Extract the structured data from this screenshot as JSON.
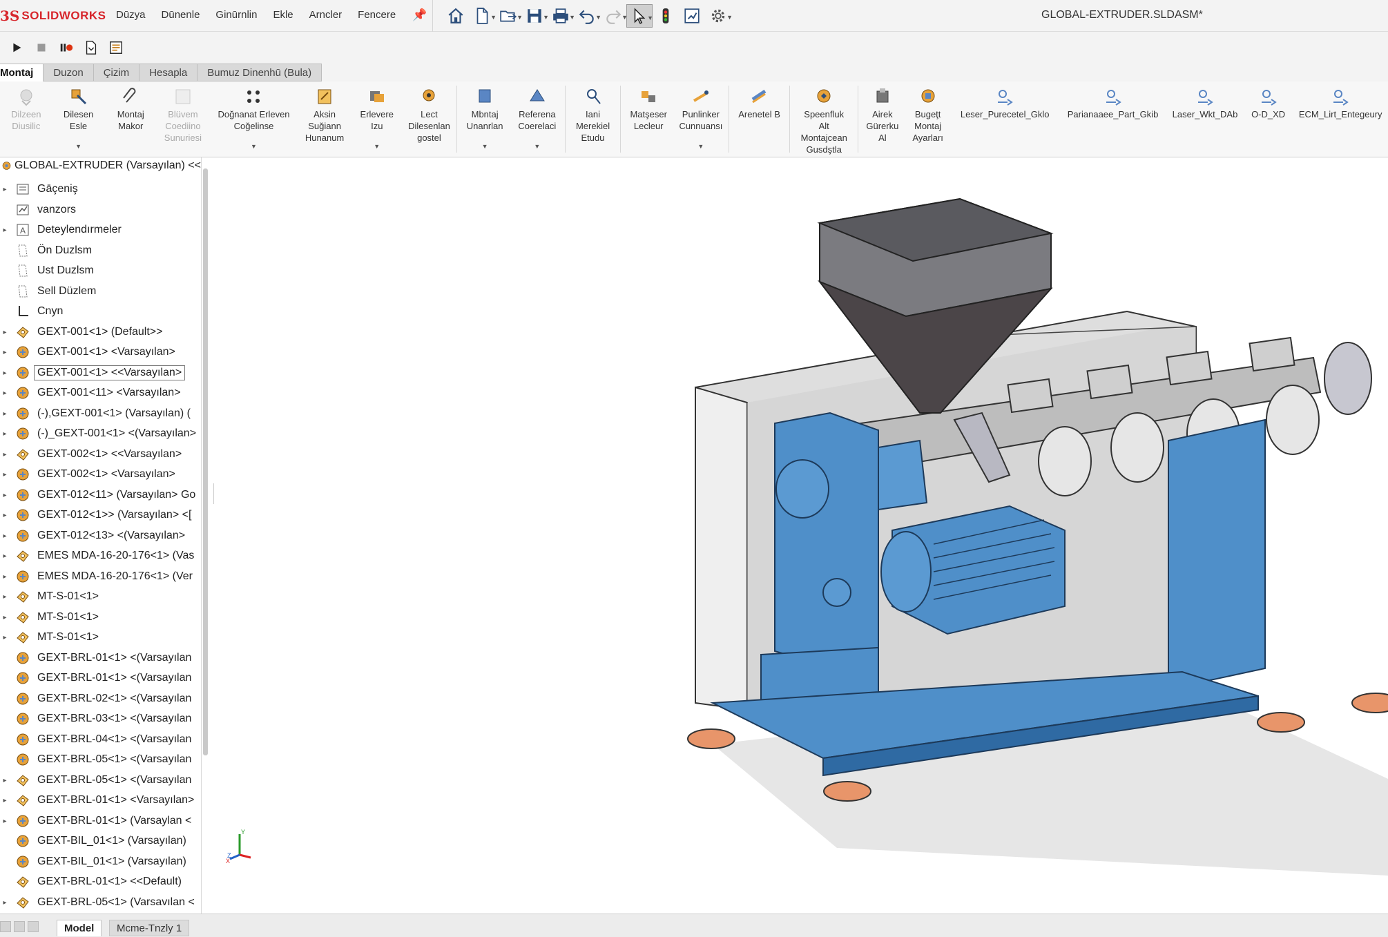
{
  "app": {
    "logo_prefix": "3S",
    "logo_name": "SOLIDWORKS",
    "document_title": "GLOBAL-EXTRUDER.SLDASM*"
  },
  "menu": [
    "Dūzya",
    "Dūnenle",
    "Ginūrnlin",
    "Ekle",
    "Arncler",
    "Fencere"
  ],
  "tabs": [
    "Montaj",
    "Duzon",
    "Çizim",
    "Hesapla",
    "Bumuz Dinenhū (Bula)"
  ],
  "ribbon": [
    {
      "label": "Dilzeen\nDiusilic",
      "icon": "insert-components-icon",
      "disabled": true
    },
    {
      "label": "Dilesen\nEsle",
      "icon": "mate-icon",
      "dropdown": true
    },
    {
      "label": "Montaj\nMakor",
      "icon": "component-preview-icon"
    },
    {
      "label": "Blüvem\nCoediino\nSunuriesi",
      "icon": "linear-pattern-icon",
      "disabled": true
    },
    {
      "label": "Doğnanat Erleven\nCoğelinse",
      "icon": "smart-fasteners-icon",
      "dropdown": true,
      "wide": true
    },
    {
      "label": "Aksin\nSuğiann\nHunanum",
      "icon": "move-component-icon"
    },
    {
      "label": "Erlevere\nIzu",
      "icon": "show-hidden-icon",
      "dropdown": true
    },
    {
      "label": "Lect\nDilesenlan\ngostel",
      "icon": "assembly-features-icon"
    },
    {
      "label": "Mbntaj\nUnanrlan",
      "icon": "reference-geometry-icon",
      "dropdown": true
    },
    {
      "label": "Referena\nCoerelaci",
      "icon": "new-motion-study-icon",
      "dropdown": true
    },
    {
      "label": "Iani\nMerekiel\nEtudu",
      "icon": "bill-of-materials-icon"
    },
    {
      "label": "Matşeser\nLecleur",
      "icon": "exploded-view-icon"
    },
    {
      "label": "Punlinker\nCunnuansı",
      "icon": "instant3d-icon",
      "dropdown": true
    },
    {
      "label": "Arenetel B",
      "icon": "update-speedpak-icon"
    },
    {
      "label": "Speenfluk\nAlt\nMontajcean\nGusdştla",
      "icon": "take-snapshot-icon"
    },
    {
      "label": "Airek\nGürerku\nAl",
      "icon": "large-assembly-icon"
    },
    {
      "label": "Bugeţt\nMontaj\nAyarları",
      "icon": "assembly-settings-icon"
    },
    {
      "label": "Leser_Purecetel_Gklo",
      "icon": "macro-icon",
      "wide2": true
    },
    {
      "label": "Parianaaee_Part_Gkib",
      "icon": "macro-icon",
      "wide2": true
    },
    {
      "label": "Laser_Wkt_DAb",
      "icon": "macro-icon",
      "wide3": true
    },
    {
      "label": "O-D_XD",
      "icon": "macro-icon"
    },
    {
      "label": "ECM_Lirt_Entegeury",
      "icon": "macro-icon",
      "wide2": true
    }
  ],
  "tree": {
    "root": "GLOBAL-EXTRUDER (Varsayılan) <<",
    "items": [
      {
        "label": "Gāçeniş",
        "icon": "history-icon",
        "expand": true
      },
      {
        "label": "vanzors",
        "icon": "sensors-icon",
        "expand": false
      },
      {
        "label": "Deteylendırmeler",
        "icon": "annotations-icon",
        "expand": true
      },
      {
        "label": "Ön Duzlsm",
        "icon": "plane-icon",
        "expand": false
      },
      {
        "label": "Ust Duzlsm",
        "icon": "plane-icon",
        "expand": false
      },
      {
        "label": "Sell Düzlem",
        "icon": "plane-icon",
        "expand": false
      },
      {
        "label": "Cnyn",
        "icon": "origin-icon",
        "expand": false
      },
      {
        "label": "GEXT-001<1> (Default>>",
        "icon": "part-icon",
        "expand": true
      },
      {
        "label": "GEXT-001<1> <Varsayılan>",
        "icon": "assembly-icon",
        "expand": true
      },
      {
        "label": "GEXT-001<1> <<Varsayılan>",
        "icon": "assembly-icon",
        "expand": true,
        "selected": true
      },
      {
        "label": "GEXT-001<11> <Varsayılan>",
        "icon": "assembly-icon",
        "expand": true
      },
      {
        "label": "(-),GEXT-001<1> (Varsayılan) (",
        "icon": "assembly-icon",
        "expand": true
      },
      {
        "label": "(-)_GEXT-001<1> <(Varsayılan>",
        "icon": "assembly-icon",
        "expand": true
      },
      {
        "label": "GEXT-002<1> <<Varsayılan>",
        "icon": "part-icon",
        "expand": true
      },
      {
        "label": "GEXT-002<1> <Varsayılan>",
        "icon": "assembly-icon",
        "expand": true
      },
      {
        "label": "GEXT-012<11> (Varsayılan> Go",
        "icon": "assembly-icon",
        "expand": true
      },
      {
        "label": "GEXT-012<1>> (Varsayılan> <[",
        "icon": "assembly-icon",
        "expand": true
      },
      {
        "label": "GEXT-012<13> <(Varsayılan>",
        "icon": "assembly-icon",
        "expand": true
      },
      {
        "label": "EMES MDA-16-20-176<1> (Vas",
        "icon": "part-icon",
        "expand": true
      },
      {
        "label": "EMES MDA-16-20-176<1> (Ver",
        "icon": "assembly-icon",
        "expand": true
      },
      {
        "label": "MT-S-01<1>",
        "icon": "part-icon",
        "expand": true
      },
      {
        "label": "MT-S-01<1>",
        "icon": "part-icon",
        "expand": true
      },
      {
        "label": "MT-S-01<1>",
        "icon": "part-icon",
        "expand": true
      },
      {
        "label": "GEXT-BRL-01<1> <(Varsayılan",
        "icon": "assembly-icon",
        "expand": false
      },
      {
        "label": "GEXT-BRL-01<1> <(Varsayılan",
        "icon": "assembly-icon",
        "expand": false
      },
      {
        "label": "GEXT-BRL-02<1> <(Varsayılan",
        "icon": "assembly-icon",
        "expand": false
      },
      {
        "label": "GEXT-BRL-03<1> <(Varsayılan",
        "icon": "assembly-icon",
        "expand": false
      },
      {
        "label": "GEXT-BRL-04<1> <(Varsayılan",
        "icon": "assembly-icon",
        "expand": false
      },
      {
        "label": "GEXT-BRL-05<1> <(Varsayılan",
        "icon": "assembly-icon",
        "expand": false
      },
      {
        "label": "GEXT-BRL-05<1> <(Varsayılan",
        "icon": "part-icon",
        "expand": true
      },
      {
        "label": "GEXT-BRL-01<1> <Varsayılan>",
        "icon": "part-icon",
        "expand": true
      },
      {
        "label": "GEXT-BRL-01<1> (Varsaylan <",
        "icon": "assembly-icon",
        "expand": true
      },
      {
        "label": "GEXT-BIL_01<1> (Varsayılan)",
        "icon": "assembly-icon",
        "expand": false
      },
      {
        "label": "GEXT-BIL_01<1> (Varsayılan)",
        "icon": "assembly-icon",
        "expand": false
      },
      {
        "label": "GEXT-BRL-01<1> <<Default)",
        "icon": "part-icon",
        "expand": false
      },
      {
        "label": "GEXT-BRL-05<1> (Varsavılan <",
        "icon": "part-icon",
        "expand": true
      }
    ]
  },
  "triad": {
    "y": "Y",
    "z": "Z",
    "x": "X"
  },
  "bottom_tabs": {
    "model": "Model",
    "motion": "Mcme-Tnzly 1"
  },
  "colors": {
    "machine_blue": "#4f8fc9",
    "frame_grey": "#d9d9d9",
    "hopper_grey": "#6e6e72",
    "feet_orange": "#e8956a",
    "logo_red": "#d7262c"
  }
}
